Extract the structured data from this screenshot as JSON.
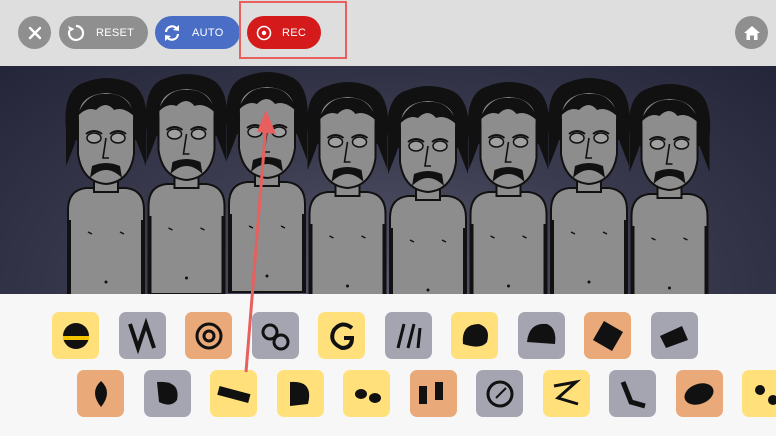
{
  "toolbar": {
    "close_icon": "close-icon",
    "reset_label": "RESET",
    "reset_icon": "reset-icon",
    "auto_label": "AUTO",
    "auto_icon": "refresh-icon",
    "rec_label": "REC",
    "rec_icon": "record-icon",
    "home_icon": "home-icon"
  },
  "colors": {
    "toolbar_bg": "#dedede",
    "gray_button": "#8f8f8f",
    "auto_blue": "#4a6dc6",
    "rec_red": "#d41a1a",
    "highlight": "#e8605e",
    "stage_dark": "#2a2a3e",
    "tray_bg": "#f7f7f7",
    "tile_yellow": "#ffe07a",
    "tile_orange": "#e9a978",
    "tile_gray": "#a5a5b2"
  },
  "stage": {
    "character_count": 8
  },
  "sound_icons_row1": [
    {
      "name": "helmet-sound-icon",
      "color": "yellow"
    },
    {
      "name": "zigzag-sound-icon",
      "color": "gray"
    },
    {
      "name": "spiral-sound-icon",
      "color": "orange"
    },
    {
      "name": "swirl-sound-icon",
      "color": "gray"
    },
    {
      "name": "glyph-sound-icon",
      "color": "yellow"
    },
    {
      "name": "sticks-sound-icon",
      "color": "gray"
    },
    {
      "name": "mask-sound-icon",
      "color": "yellow"
    },
    {
      "name": "cap-sound-icon",
      "color": "gray"
    },
    {
      "name": "cube-sound-icon",
      "color": "orange"
    },
    {
      "name": "hat-sound-icon",
      "color": "gray"
    }
  ],
  "sound_icons_row2": [
    {
      "name": "drop-sound-icon",
      "color": "orange"
    },
    {
      "name": "balloon-sound-icon",
      "color": "gray"
    },
    {
      "name": "bar-sound-icon",
      "color": "yellow"
    },
    {
      "name": "leaf-sound-icon",
      "color": "yellow"
    },
    {
      "name": "glasses-sound-icon",
      "color": "yellow"
    },
    {
      "name": "stripes-sound-icon",
      "color": "orange"
    },
    {
      "name": "clock-sound-icon",
      "color": "gray"
    },
    {
      "name": "zeta-sound-icon",
      "color": "yellow"
    },
    {
      "name": "wave-sound-icon",
      "color": "gray"
    },
    {
      "name": "disc-sound-icon",
      "color": "orange"
    },
    {
      "name": "face-sound-icon",
      "color": "yellow"
    }
  ]
}
